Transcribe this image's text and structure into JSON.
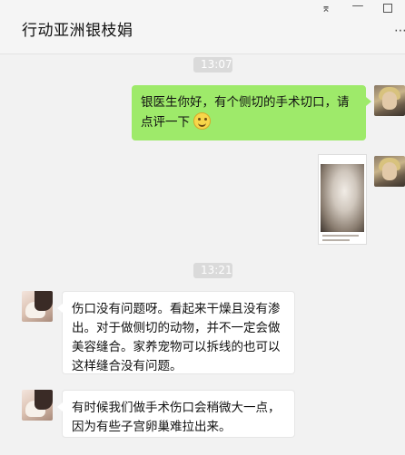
{
  "window": {
    "chat_title": "行动亚洲银枝娟",
    "controls": {
      "pin": "⌆",
      "minimize": "—",
      "more": "⋯"
    }
  },
  "messages": [
    {
      "type": "timestamp",
      "text": "13:07"
    },
    {
      "type": "text",
      "side": "self",
      "text": "银医生你好，有个侧切的手术切口，请点评一下",
      "emoji": "smile-icon"
    },
    {
      "type": "image",
      "side": "self"
    },
    {
      "type": "timestamp",
      "text": "13:21"
    },
    {
      "type": "text",
      "side": "other",
      "text": "伤口没有问题呀。看起来干燥且没有渗出。对于做侧切的动物，并不一定会做美容缝合。家养宠物可以拆线的也可以这样缝合没有问题。"
    },
    {
      "type": "text",
      "side": "other",
      "text": "有时候我们做手术伤口会稍微大一点，因为有些子宫卵巢难拉出来。"
    }
  ],
  "colors": {
    "self_bubble": "#9eea6a",
    "other_bubble": "#ffffff",
    "background": "#f2f2f2",
    "timestamp_bg": "#dadada"
  }
}
